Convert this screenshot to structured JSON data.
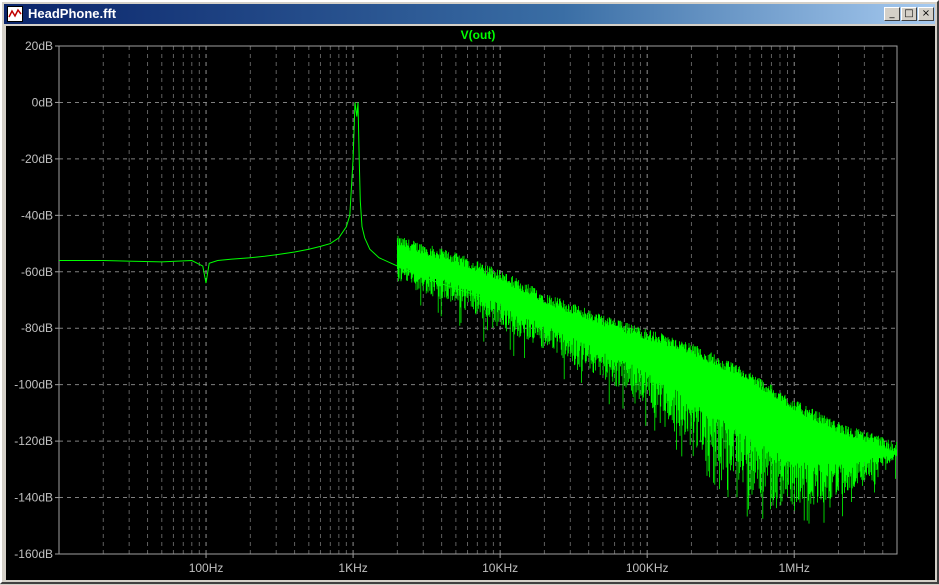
{
  "window": {
    "title": "HeadPhone.fft",
    "minimize_glyph": "_",
    "maximize_glyph": "□",
    "close_glyph": "×",
    "icon": "waveform-app-icon"
  },
  "chart_data": {
    "type": "line",
    "title": "V(out)",
    "xlabel": "",
    "ylabel": "",
    "x_scale": "log",
    "xlim": [
      10,
      5000000
    ],
    "ylim": [
      -160,
      20
    ],
    "grid": true,
    "x_tick_labels": [
      "100Hz",
      "1KHz",
      "10KHz",
      "100KHz",
      "1MHz"
    ],
    "x_tick_values": [
      100,
      1000,
      10000,
      100000,
      1000000
    ],
    "y_tick_labels": [
      "20dB",
      "0dB",
      "-20dB",
      "-40dB",
      "-60dB",
      "-80dB",
      "-100dB",
      "-120dB",
      "-140dB",
      "-160dB"
    ],
    "y_tick_values": [
      20,
      0,
      -20,
      -40,
      -60,
      -80,
      -100,
      -120,
      -140,
      -160
    ],
    "series": [
      {
        "name": "V(out)",
        "color": "#00ff00",
        "x": [
          10,
          20,
          50,
          80,
          95,
          100,
          105,
          120,
          150,
          200,
          250,
          300,
          400,
          500,
          600,
          700,
          800,
          900,
          950,
          1000,
          1030,
          1060,
          1080,
          1100,
          1120,
          1150,
          1200,
          1300,
          1500,
          2000,
          3000,
          5000,
          10000,
          20000,
          50000,
          100000,
          200000,
          500000,
          1000000,
          2000000,
          5000000
        ],
        "y": [
          -56,
          -56,
          -56.5,
          -56,
          -58,
          -64,
          -57,
          -56,
          -55.5,
          -55,
          -54.5,
          -54,
          -53,
          -52,
          -51,
          -50,
          -48,
          -44,
          -40,
          -20,
          0,
          -5,
          0,
          -20,
          -35,
          -44,
          -48,
          -52,
          -55,
          -58,
          -62,
          -66,
          -71,
          -76,
          -83,
          -89,
          -96,
          -107,
          -115,
          -120,
          -124
        ]
      }
    ],
    "envelope_upper": {
      "x": [
        2000,
        5000,
        10000,
        20000,
        50000,
        100000,
        200000,
        500000,
        1000000,
        2000000,
        5000000
      ],
      "y": [
        -50,
        -56,
        -62,
        -70,
        -78,
        -83,
        -88,
        -98,
        -108,
        -116,
        -123
      ]
    },
    "envelope_lower": {
      "x": [
        2000,
        5000,
        10000,
        20000,
        50000,
        100000,
        200000,
        500000,
        1000000,
        2000000,
        5000000
      ],
      "y": [
        -64,
        -72,
        -80,
        -88,
        -98,
        -108,
        -122,
        -140,
        -145,
        -140,
        -126
      ]
    }
  }
}
